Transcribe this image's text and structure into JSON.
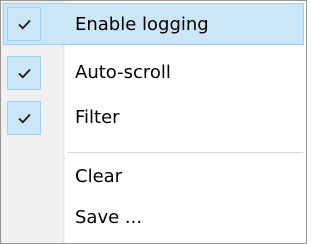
{
  "context_menu": {
    "items": [
      {
        "label": "Enable logging",
        "checked": true,
        "highlighted": true,
        "icon": "checkmark-icon"
      },
      {
        "label": "Auto-scroll",
        "checked": true,
        "highlighted": false,
        "icon": "checkmark-icon"
      },
      {
        "label": "Filter",
        "checked": true,
        "highlighted": false,
        "icon": "checkmark-icon"
      },
      {
        "label": "Clear",
        "checked": false,
        "highlighted": false
      },
      {
        "label": "Save ...",
        "checked": false,
        "highlighted": false
      }
    ]
  },
  "colors": {
    "highlight_bg": "#cde6f7",
    "highlight_border": "#99d1ff",
    "gutter_bg": "#f0f0f0",
    "separator": "#d7d7d7"
  }
}
